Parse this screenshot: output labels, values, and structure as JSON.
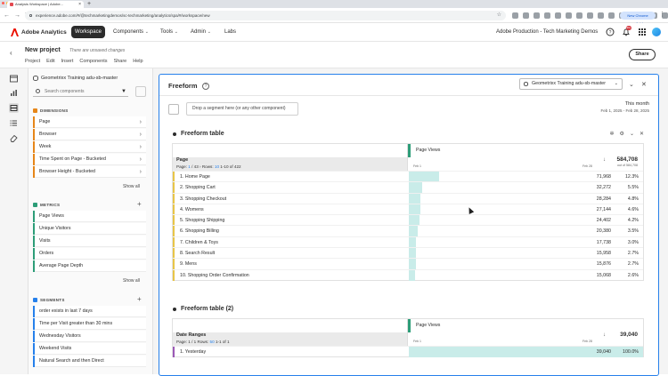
{
  "browser": {
    "tab_title": "Analysis Workspace | Adobe...",
    "url": "experience.adobe.com/#/@techmarketingdemos/sc-techmarketing/analytics/spa/#/workspace/new",
    "update_label": "New Chrome available"
  },
  "app": {
    "name": "Adobe Analytics",
    "workspace_label": "Workspace",
    "nav": [
      "Components",
      "Tools",
      "Admin",
      "Labs"
    ],
    "org": "Adobe Production - Tech Marketing Demos",
    "notif_count": "99+"
  },
  "project": {
    "title": "New project",
    "unsaved": "There are unsaved changes",
    "menu": [
      "Project",
      "Edit",
      "Insert",
      "Components",
      "Share",
      "Help"
    ],
    "share_label": "Share"
  },
  "panel": {
    "report_suite": "Geometrixx Training adu-sb-master",
    "search_placeholder": "Search components",
    "dimensions_label": "DIMENSIONS",
    "dimensions": [
      "Page",
      "Browser",
      "Week",
      "Time Spent on Page - Bucketed",
      "Browser Height - Bucketed"
    ],
    "metrics_label": "METRICS",
    "metrics": [
      "Page Views",
      "Unique Visitors",
      "Visits",
      "Orders",
      "Average Page Depth"
    ],
    "segments_label": "SEGMENTS",
    "segments": [
      "order exists in last 7 days",
      "Time per Visit greater than 30 mins",
      "Wednesday Visitors",
      "Weekend Visits",
      "Natural Search and then Direct"
    ],
    "show_all": "Show all"
  },
  "freeform": {
    "title": "Freeform",
    "report_suite": "Geometrixx Training adu-sb-master",
    "drop_zone": "Drop a segment here (or any other component)",
    "date_label": "This month",
    "date_range": "Feb 1, 2025 - Feb 28, 2025"
  },
  "table1": {
    "title": "Freeform table",
    "dimension": "Page",
    "page_info": {
      "pre": "Page: ",
      "page": "1",
      "of": " / 43 › Rows: ",
      "rows": "10",
      "range": " 1-10 of 422"
    },
    "metric": "Page Views",
    "date_start": "Feb 1",
    "date_end": "Feb 28",
    "total": "584,708",
    "total_pct": "out of 584,708",
    "rows": [
      {
        "label": "1. Home Page",
        "value": "71,968",
        "pct": "12.3%",
        "share": 0.123
      },
      {
        "label": "2. Shopping Cart",
        "value": "32,272",
        "pct": "5.5%",
        "share": 0.055
      },
      {
        "label": "3. Shopping Checkout",
        "value": "28,284",
        "pct": "4.8%",
        "share": 0.048
      },
      {
        "label": "4. Womens",
        "value": "27,144",
        "pct": "4.6%",
        "share": 0.046
      },
      {
        "label": "5. Shopping Shipping",
        "value": "24,402",
        "pct": "4.2%",
        "share": 0.042
      },
      {
        "label": "6. Shopping Billing",
        "value": "20,380",
        "pct": "3.5%",
        "share": 0.035
      },
      {
        "label": "7. Children & Toys",
        "value": "17,738",
        "pct": "3.0%",
        "share": 0.03
      },
      {
        "label": "8. Search Result",
        "value": "15,958",
        "pct": "2.7%",
        "share": 0.027
      },
      {
        "label": "9. Mens",
        "value": "15,876",
        "pct": "2.7%",
        "share": 0.027
      },
      {
        "label": "10. Shopping Order Confirmation",
        "value": "15,068",
        "pct": "2.6%",
        "share": 0.026
      }
    ]
  },
  "table2": {
    "title": "Freeform table (2)",
    "dimension": "Date Ranges",
    "page_info": {
      "pre": "Page: 1 / 1 Rows: ",
      "rows": "50",
      "range": " 1-1 of 1"
    },
    "metric": "Page Views",
    "date_start": "Feb 1",
    "date_end": "Feb 28",
    "total": "39,040",
    "rows": [
      {
        "label": "1. Yesterday",
        "value": "39,040",
        "pct": "100.0%",
        "share": 1.0
      }
    ]
  }
}
